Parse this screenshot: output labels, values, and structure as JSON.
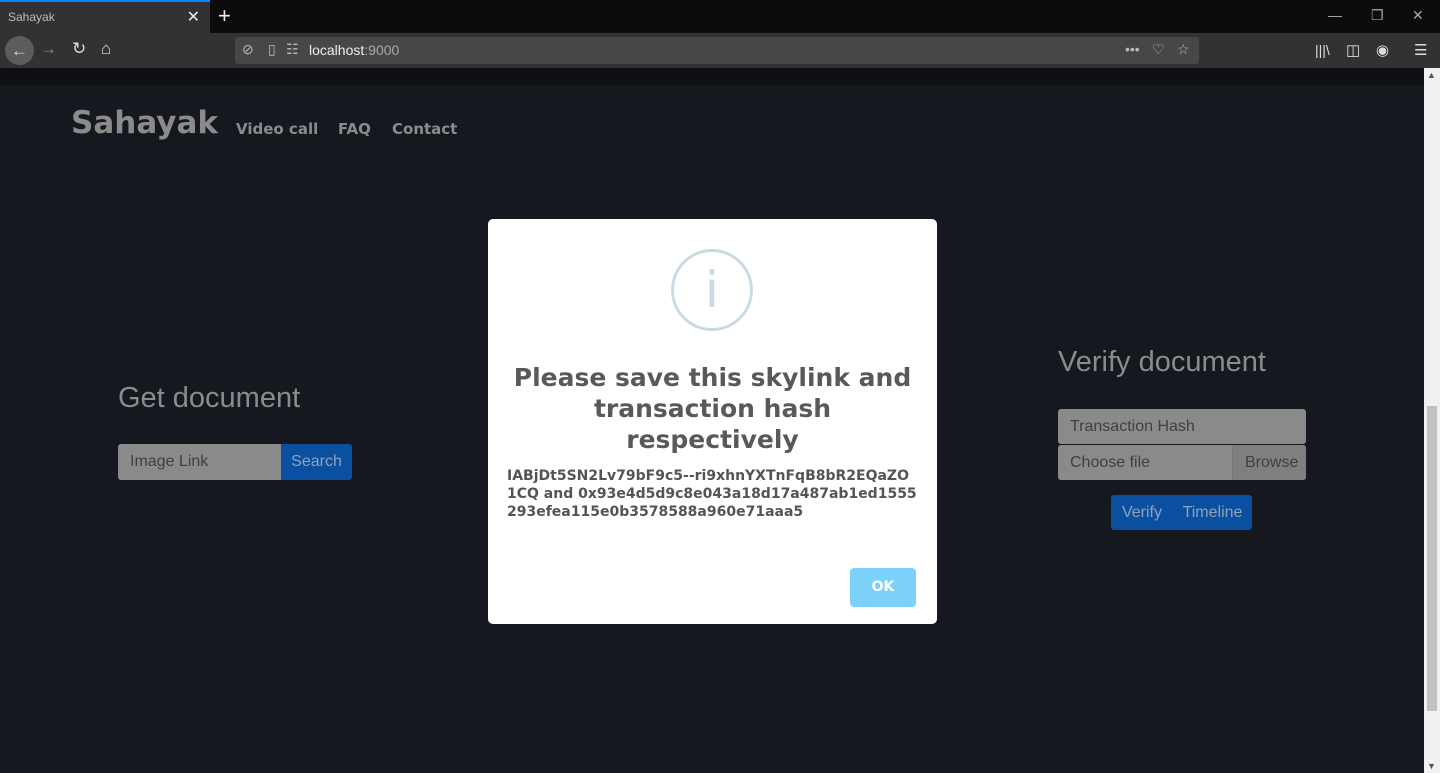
{
  "browser": {
    "tab_title": "Sahayak",
    "url_host": "localhost",
    "url_port": ":9000"
  },
  "nav": {
    "brand": "Sahayak",
    "links": [
      "Video call",
      "FAQ",
      "Contact"
    ]
  },
  "get_document": {
    "heading": "Get document",
    "input_placeholder": "Image Link",
    "search_label": "Search"
  },
  "verify_document": {
    "heading": "Verify document",
    "hash_placeholder": "Transaction Hash",
    "file_placeholder": "Choose file",
    "browse_label": "Browse",
    "verify_label": "Verify",
    "timeline_label": "Timeline"
  },
  "modal": {
    "icon": "info-icon",
    "title": "Please save this skylink and transaction hash respectively",
    "text": "IABjDt5SN2Lv79bF9c5--ri9xhnYXTnFqB8bR2EQaZO1CQ and 0x93e4d5d9c8e043a18d17a487ab1ed1555293efea115e0b3578588a960e71aaa5",
    "ok_label": "OK"
  },
  "colors": {
    "primary": "#0a4fa0",
    "ok_button": "#7cd1f9",
    "background": "#15181e"
  }
}
